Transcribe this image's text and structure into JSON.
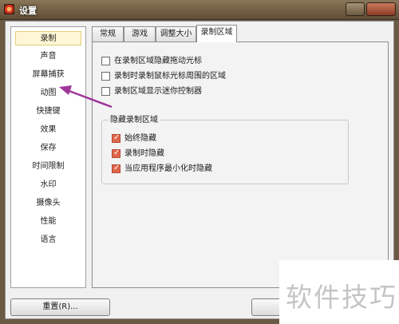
{
  "window": {
    "title": "设置"
  },
  "sidebar": {
    "items": [
      {
        "label": "录制",
        "selected": true
      },
      {
        "label": "声音",
        "selected": false
      },
      {
        "label": "屏幕捕获",
        "selected": false
      },
      {
        "label": "动图",
        "selected": false
      },
      {
        "label": "快捷键",
        "selected": false
      },
      {
        "label": "效果",
        "selected": false
      },
      {
        "label": "保存",
        "selected": false
      },
      {
        "label": "时间限制",
        "selected": false
      },
      {
        "label": "水印",
        "selected": false
      },
      {
        "label": "摄像头",
        "selected": false
      },
      {
        "label": "性能",
        "selected": false
      },
      {
        "label": "语言",
        "selected": false
      }
    ]
  },
  "tabs": [
    {
      "label": "常规",
      "active": false
    },
    {
      "label": "游戏",
      "active": false
    },
    {
      "label": "调整大小",
      "active": false
    },
    {
      "label": "录制区域",
      "active": true
    }
  ],
  "options": [
    {
      "label": "在录制区域隐藏拖动光标",
      "checked": false
    },
    {
      "label": "录制时录制鼠标光标周围的区域",
      "checked": false
    },
    {
      "label": "录制区域显示迷你控制器",
      "checked": false
    }
  ],
  "hide_group": {
    "title": "隐藏录制区域",
    "options": [
      {
        "label": "始终隐藏",
        "checked": true
      },
      {
        "label": "录制时隐藏",
        "checked": true
      },
      {
        "label": "当应用程序最小化时隐藏",
        "checked": true
      }
    ]
  },
  "footer": {
    "reset_label": "重置(R)...",
    "ok_label": "确"
  },
  "watermark": {
    "text": "软件技巧"
  },
  "colors": {
    "accent": "#e0664a",
    "annotation_arrow": "#a0359a",
    "selected_bg": "#fff7d6",
    "titlebar": "#6b5a44"
  },
  "icons": {
    "app": "red-record-icon",
    "checkmark": "check-icon"
  }
}
